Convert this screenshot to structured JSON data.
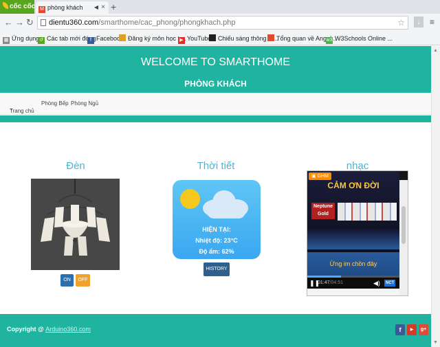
{
  "browser": {
    "brand": "cốc cốc",
    "tab_title": "phòng khách",
    "new_tab": "+",
    "url_host": "dientu360.com",
    "url_path": "/smarthome/cac_phong/phongkhach.php",
    "bookmarks": [
      {
        "label": "Ứng dụng",
        "icon": "apps-icon",
        "color": "#888888"
      },
      {
        "label": "Các tab mới đóng",
        "icon": "recent-icon",
        "color": "#5aa51e"
      },
      {
        "label": "Facebook",
        "icon": "facebook-icon",
        "color": "#3b5998"
      },
      {
        "label": "Đăng ký môn học tr...",
        "icon": "page-icon",
        "color": "#e0a020"
      },
      {
        "label": "YouTube",
        "icon": "youtube-icon",
        "color": "#e52d27"
      },
      {
        "label": "Chiếu sáng thông m...",
        "icon": "page-icon",
        "color": "#222222"
      },
      {
        "label": "Tổng quan về Angul...",
        "icon": "page-icon",
        "color": "#e34a2e"
      },
      {
        "label": "W3Schools Online ...",
        "icon": "w3-icon",
        "color": "#4caf50"
      }
    ]
  },
  "header": {
    "title": "WELCOME TO SMARTHOME",
    "subtitle": "PHÒNG KHÁCH"
  },
  "nav": {
    "items": [
      {
        "label": "Trang chủ",
        "dropdown": true
      },
      {
        "label": "Phòng Bếp"
      },
      {
        "label": "Phòng Ngủ"
      }
    ]
  },
  "light": {
    "title": "Đèn",
    "on_label": "ON",
    "off_label": "OFF"
  },
  "weather": {
    "title": "Thời tiết",
    "now_label": "HIỆN TẠI:",
    "temperature": "Nhiệt độ: 23°C",
    "humidity": "Độ ẩm: 62%",
    "history_label": "HISTORY"
  },
  "music": {
    "title": "nhạc",
    "badge": "GHM",
    "poster_heading": "CẢM ƠN ĐỜI",
    "poster_brand": "Neptune Gold",
    "song_title": "Ừng im chồn đây",
    "time_current": "01:47",
    "time_total": "04:51",
    "progress": 0.367,
    "sound_label": "NCT",
    "time_sep": "/"
  },
  "footer": {
    "copyright": "Copyright @",
    "link": "Arduino360.com"
  },
  "colors": {
    "primary": "#20b3a0",
    "on_button": "#2a6fb0",
    "off_button": "#f0a32b",
    "title_blue": "#4bb4d6"
  }
}
